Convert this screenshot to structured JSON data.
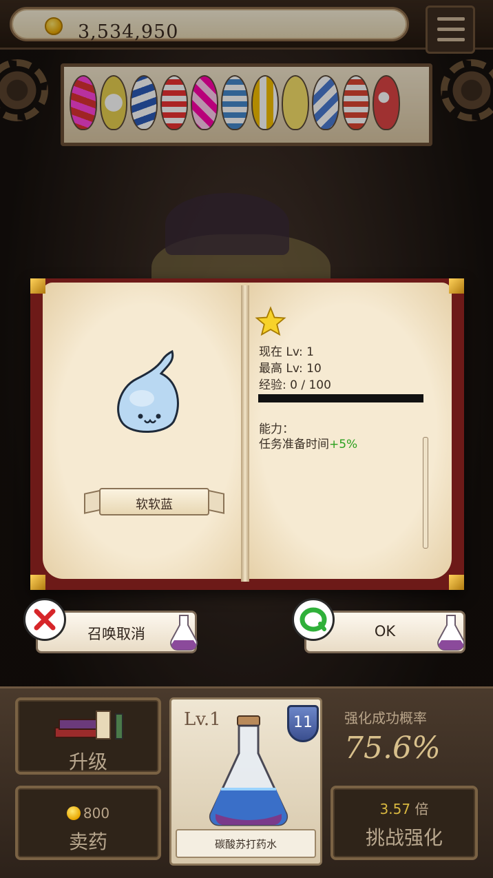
{
  "header": {
    "gold": "3,534,950"
  },
  "book": {
    "creature_name": "软软蓝",
    "current_level": "现在 Lv: 1",
    "max_level": "最高 Lv: 10",
    "experience": "经验: 0 / 100",
    "experience_progress": 0,
    "ability_label": "能力：",
    "ability_text": "任务准备时间",
    "ability_bonus": "+5%"
  },
  "dialog": {
    "cancel_label": "召唤取消",
    "ok_label": "OK"
  },
  "bottom": {
    "upgrade_label": "升级",
    "sell_price": "800",
    "sell_label": "卖药",
    "potion_level": "Lv.1",
    "potion_badge": "11",
    "potion_name": "碳酸苏打药水",
    "rate_title": "强化成功概率",
    "rate_value": "75.6%",
    "multiplier_value": "3.57",
    "multiplier_unit": "倍",
    "challenge_label": "挑战强化"
  },
  "colors": {
    "gold_text": "#3a2a20",
    "bonus_green": "#2aa01e",
    "book_cover": "#6d1a18",
    "page": "#f6ead2",
    "button_face": "#fdf8ef"
  },
  "icons": {
    "coin": "coin-icon",
    "menu": "menu-icon",
    "star": "star-icon",
    "cancel": "cancel-icon",
    "confirm": "confirm-icon",
    "flask": "flask-icon",
    "shield": "shield-badge-icon",
    "books": "books-icon"
  }
}
